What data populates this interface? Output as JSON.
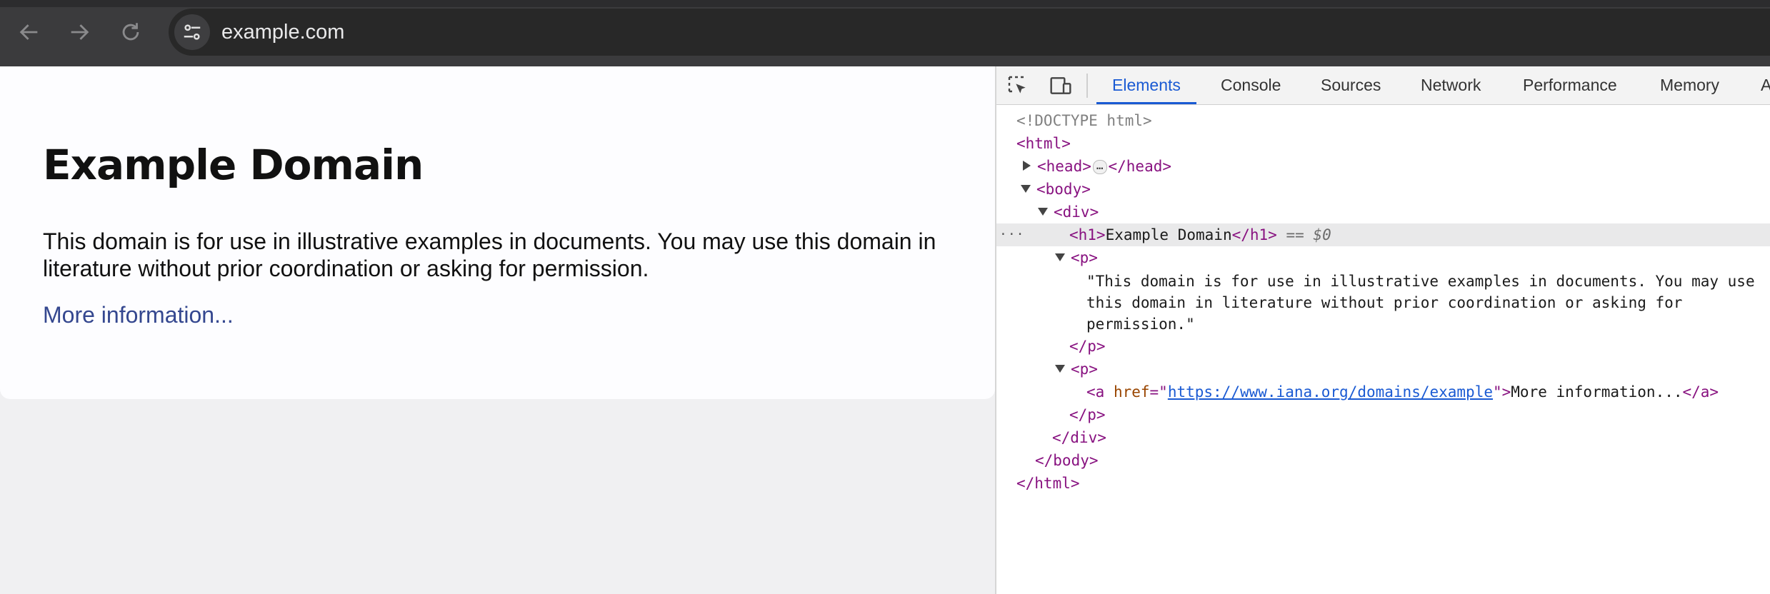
{
  "browser": {
    "url": "example.com",
    "icons": {
      "back": "arrow-left-icon",
      "forward": "arrow-right-icon",
      "reload": "reload-icon",
      "site_info": "tune-icon"
    }
  },
  "page": {
    "title": "Example Domain",
    "paragraph": "This domain is for use in illustrative examples in documents. You may use this domain in literature without prior coordination or asking for permission.",
    "link_text": "More information..."
  },
  "devtools": {
    "tabs": [
      "Elements",
      "Console",
      "Sources",
      "Network",
      "Performance",
      "Memory",
      "A"
    ],
    "active_tab": "Elements",
    "tools": [
      "inspect-element-icon",
      "device-toolbar-icon"
    ],
    "dom": {
      "doctype": "<!DOCTYPE html>",
      "html_open": "<html>",
      "head_open": "<head>",
      "head_ellipsis": "…",
      "head_close": "</head>",
      "body_open": "<body>",
      "div_open": "<div>",
      "h1_open": "<h1>",
      "h1_text": "Example Domain",
      "h1_close": "</h1>",
      "h1_marker_eq": "==",
      "h1_marker_var": "$0",
      "p_open": "<p>",
      "p_text": "\"This domain is for use in illustrative examples in documents. You may use this domain in literature without prior coordination or asking for permission.\"",
      "p_close": "</p>",
      "a_open_start": "<a",
      "a_attr_name": "href",
      "a_attr_eq": "=\"",
      "a_href": "https://www.iana.org/domains/example",
      "a_attr_end": "\">",
      "a_text": "More information...",
      "a_close": "</a>",
      "div_close": "</div>",
      "body_close": "</body>",
      "html_close": "</html>",
      "row_menu": "···"
    }
  },
  "colors": {
    "tag": "#881280",
    "attr_name": "#994500",
    "link": "#1a5ad3",
    "page_link": "#34478f",
    "active_tab": "#1a5ad3"
  }
}
